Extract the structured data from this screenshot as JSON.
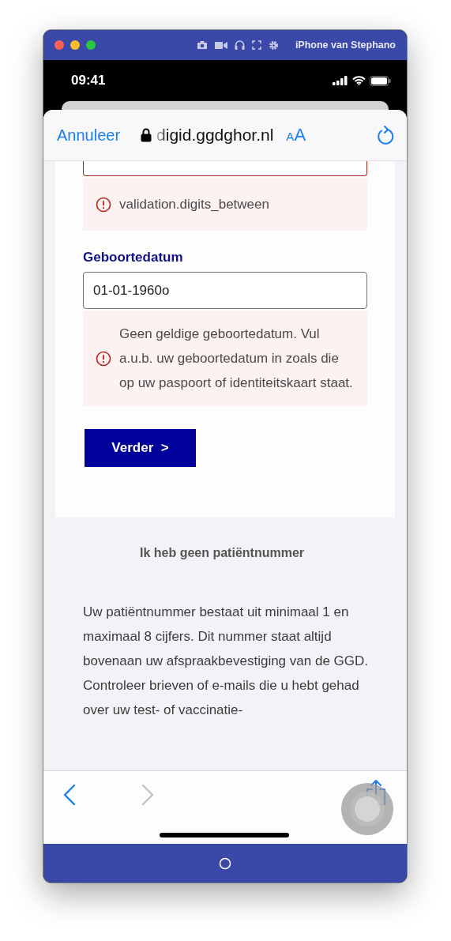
{
  "device_window": {
    "title": "iPhone van Stephano"
  },
  "status_bar": {
    "time": "09:41"
  },
  "browser": {
    "cancel": "Annuleer",
    "url": "digid.ggdghor.nl",
    "text_size": "AA"
  },
  "fields": [
    {
      "kind": "cut",
      "invalid": true,
      "error": "validation.digits_between"
    },
    {
      "kind": "input",
      "label": "Geboortedatum",
      "value": "01-01-1960o",
      "invalid": false,
      "error": "Geen geldige geboortedatum. Vul a.u.b. uw geboortedatum in zoals die op uw paspoort of identiteitskaart staat."
    }
  ],
  "submit": "Verder  >",
  "help": {
    "heading": "Ik heb geen patiëntnummer",
    "text": "Uw patiëntnummer bestaat uit minimaal 1 en maximaal 8 cijfers. Dit nummer staat altijd bovenaan uw afspraakbevestiging van de GGD. Controleer brieven of e-mails die u hebt gehad over uw test- of vaccinatie-"
  },
  "toolbar": {
    "back_disabled": false,
    "forward_disabled": true
  }
}
